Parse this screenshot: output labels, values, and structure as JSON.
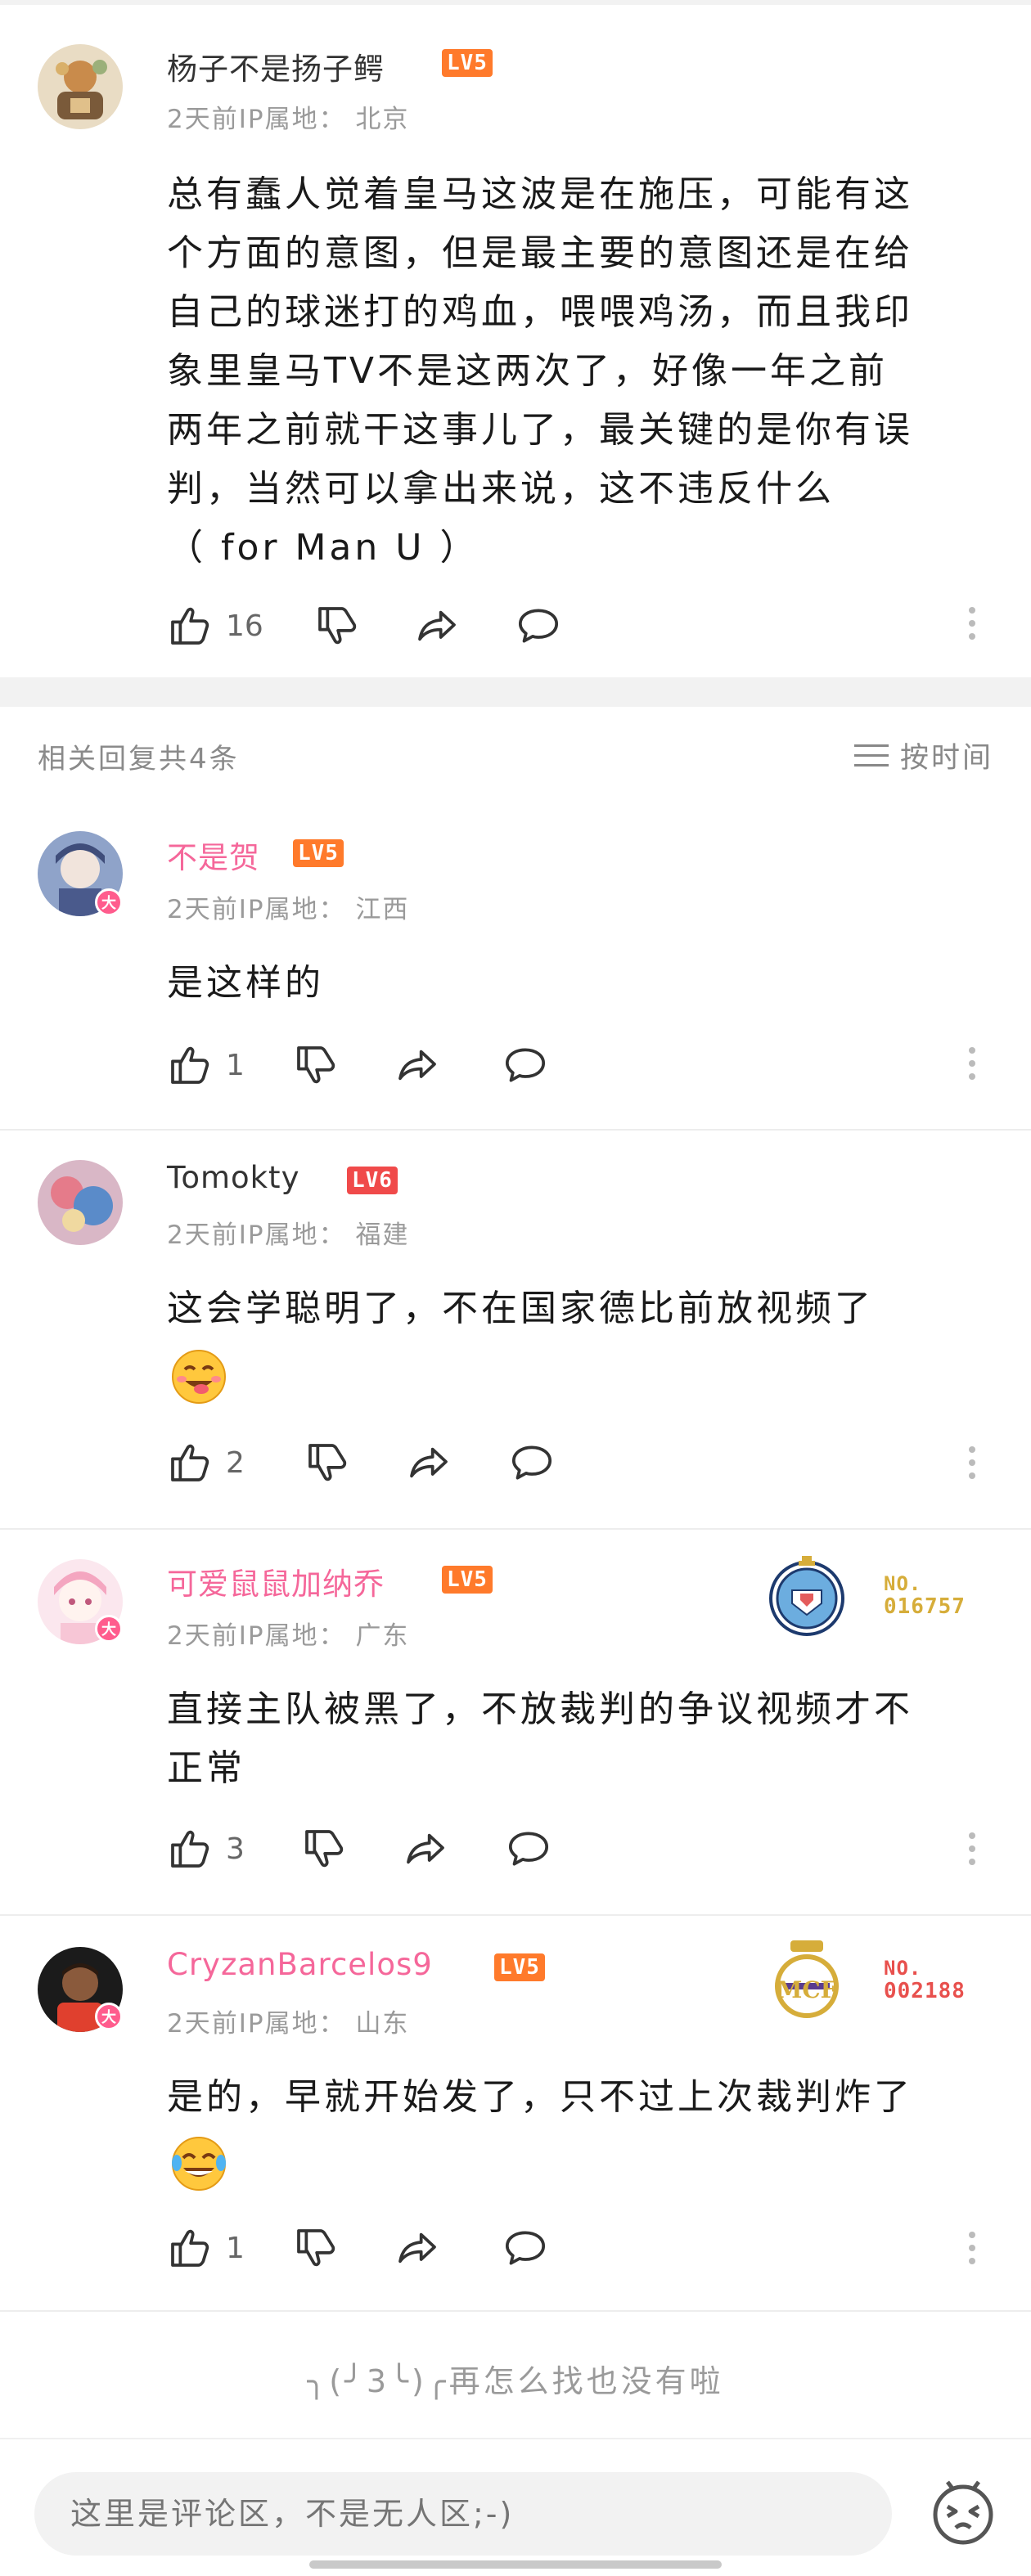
{
  "main_comment": {
    "username": "杨子不是扬子鳄",
    "level": "LV5",
    "time": "2天前",
    "ip_label": "IP属地：",
    "ip": "北京",
    "text_lines": [
      "总有蠢人觉着皇马这波是在施压，可能有这",
      "个方面的意图，但是最主要的意图还是在给",
      "自己的球迷打的鸡血，喂喂鸡汤，而且我印",
      "象里皇马TV不是这两次了，好像一年之前",
      "两年之前就干这事儿了，最关键的是你有误",
      "判，当然可以拿出来说，这不违反什么",
      "（ for Man U ）"
    ],
    "likes": "16"
  },
  "replies_header": {
    "title": "相关回复共4条",
    "sort_label": "按时间"
  },
  "replies": [
    {
      "username": "不是贺",
      "level": "LV5",
      "time": "2天前",
      "ip_label": "IP属地：",
      "ip": "江西",
      "text": "是这样的",
      "likes": "1"
    },
    {
      "username": "Tomokty",
      "level": "LV6",
      "time": "2天前",
      "ip_label": "IP属地：",
      "ip": "福建",
      "text": "这会学聪明了，不在国家德比前放视频了",
      "likes": "2"
    },
    {
      "username": "可爱鼠鼠加纳乔",
      "level": "LV5",
      "time": "2天前",
      "ip_label": "IP属地：",
      "ip": "广东",
      "text_lines": [
        "直接主队被黑了，不放裁判的争议视频才不",
        "正常"
      ],
      "likes": "3",
      "medal_no_prefix": "NO.",
      "medal_no": "016757"
    },
    {
      "username": "CryzanBarcelos9",
      "level": "LV5",
      "time": "2天前",
      "ip_label": "IP属地：",
      "ip": "山东",
      "text": "是的，早就开始发了，只不过上次裁判炸了",
      "likes": "1",
      "medal_no_prefix": "NO.",
      "medal_no": "002188"
    }
  ],
  "end_text": "╮(╯3╰)╭再怎么找也没有啦",
  "badge_da": "大",
  "input_placeholder": "这里是评论区，不是无人区;-)",
  "colors": {
    "pink_name": "#f5679a",
    "level_orange": "#ff7a2b",
    "level_red": "#f04a4a",
    "medal_gold": "#d6ad3a",
    "medal_red": "#e8504d"
  }
}
